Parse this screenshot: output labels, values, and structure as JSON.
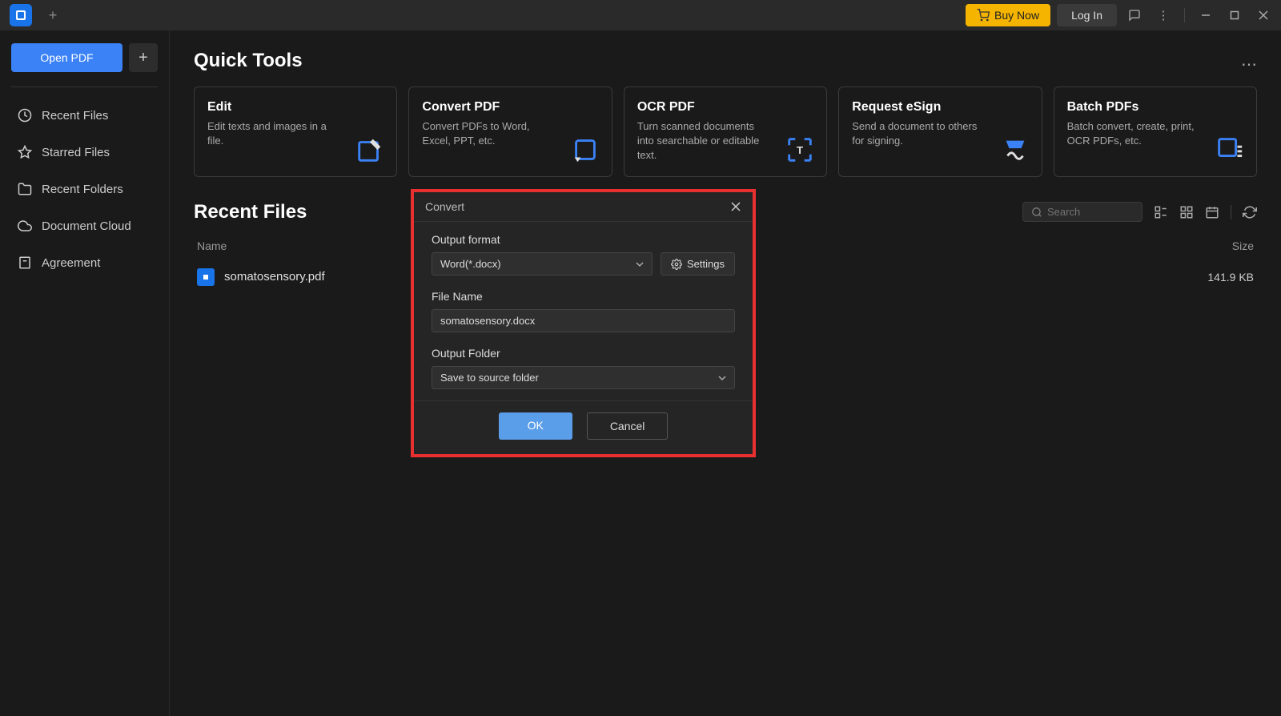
{
  "topbar": {
    "buy_now": "Buy Now",
    "log_in": "Log In"
  },
  "sidebar": {
    "open_pdf": "Open PDF",
    "items": [
      {
        "label": "Recent Files"
      },
      {
        "label": "Starred Files"
      },
      {
        "label": "Recent Folders"
      },
      {
        "label": "Document Cloud"
      },
      {
        "label": "Agreement"
      }
    ]
  },
  "quick_tools": {
    "title": "Quick Tools",
    "cards": [
      {
        "title": "Edit",
        "desc": "Edit texts and images in a file."
      },
      {
        "title": "Convert PDF",
        "desc": "Convert PDFs to Word, Excel, PPT, etc."
      },
      {
        "title": "OCR PDF",
        "desc": "Turn scanned documents into searchable or editable text."
      },
      {
        "title": "Request eSign",
        "desc": "Send a document to others for signing."
      },
      {
        "title": "Batch PDFs",
        "desc": "Batch convert, create, print, OCR PDFs, etc."
      }
    ]
  },
  "recent": {
    "title": "Recent Files",
    "search_placeholder": "Search",
    "col_name": "Name",
    "col_size": "Size",
    "files": [
      {
        "name": "somatosensory.pdf",
        "size": "141.9 KB"
      }
    ]
  },
  "dialog": {
    "title": "Convert",
    "output_format_label": "Output format",
    "output_format_value": "Word(*.docx)",
    "settings_label": "Settings",
    "file_name_label": "File Name",
    "file_name_value": "somatosensory.docx",
    "output_folder_label": "Output Folder",
    "output_folder_value": "Save to source folder",
    "ok": "OK",
    "cancel": "Cancel"
  }
}
